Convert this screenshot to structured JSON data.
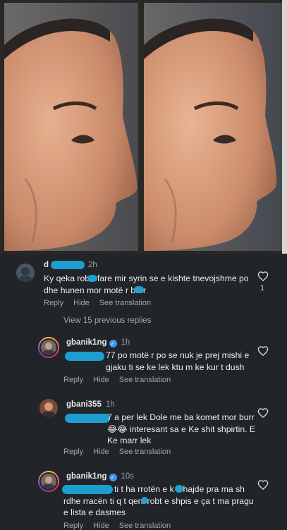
{
  "photos": {
    "left": {
      "description_icon": "profile-photo-before"
    },
    "right": {
      "description_icon": "profile-photo-after"
    }
  },
  "comments": [
    {
      "username": "d",
      "time": "2h",
      "text": "Ky qeka rob r fare mir syrin se e kishte tnevojshme po dhe hunen mor motë r burr",
      "likes": "1",
      "reply": "Reply",
      "hide": "Hide",
      "see_translation": "See translation"
    },
    {
      "view_replies": "View 15 previous replies"
    },
    {
      "username": "gbanik1ng",
      "time": "1h",
      "text": "77 po motë r po se nuk je prej mishi e gjaku ti se ke lek ktu m ke kur t dush",
      "reply": "Reply",
      "hide": "Hide",
      "see_translation": "See translation"
    },
    {
      "username": "gbani355",
      "time": "1h",
      "text": "7 a per lek Dole me ba komet mor burr 😂😂 interesant sa e Ke shit shpirtin. E Ke marr lek",
      "reply": "Reply",
      "hide": "Hide",
      "see_translation": "See translation"
    },
    {
      "username": "gbanik1ng",
      "time": "10s",
      "text": "ti t ha rrotën e k it hajde pra ma sh rdhe rracën ti q t qeni robt e shpis e ça t ma pragu e lista e dasmes",
      "reply": "Reply",
      "hide": "Hide",
      "see_translation": "See translation"
    }
  ],
  "colors": {
    "background": "#212429",
    "redaction": "#1fa5d9",
    "verified": "#3897f0",
    "secondary_text": "#a4a8ae"
  }
}
